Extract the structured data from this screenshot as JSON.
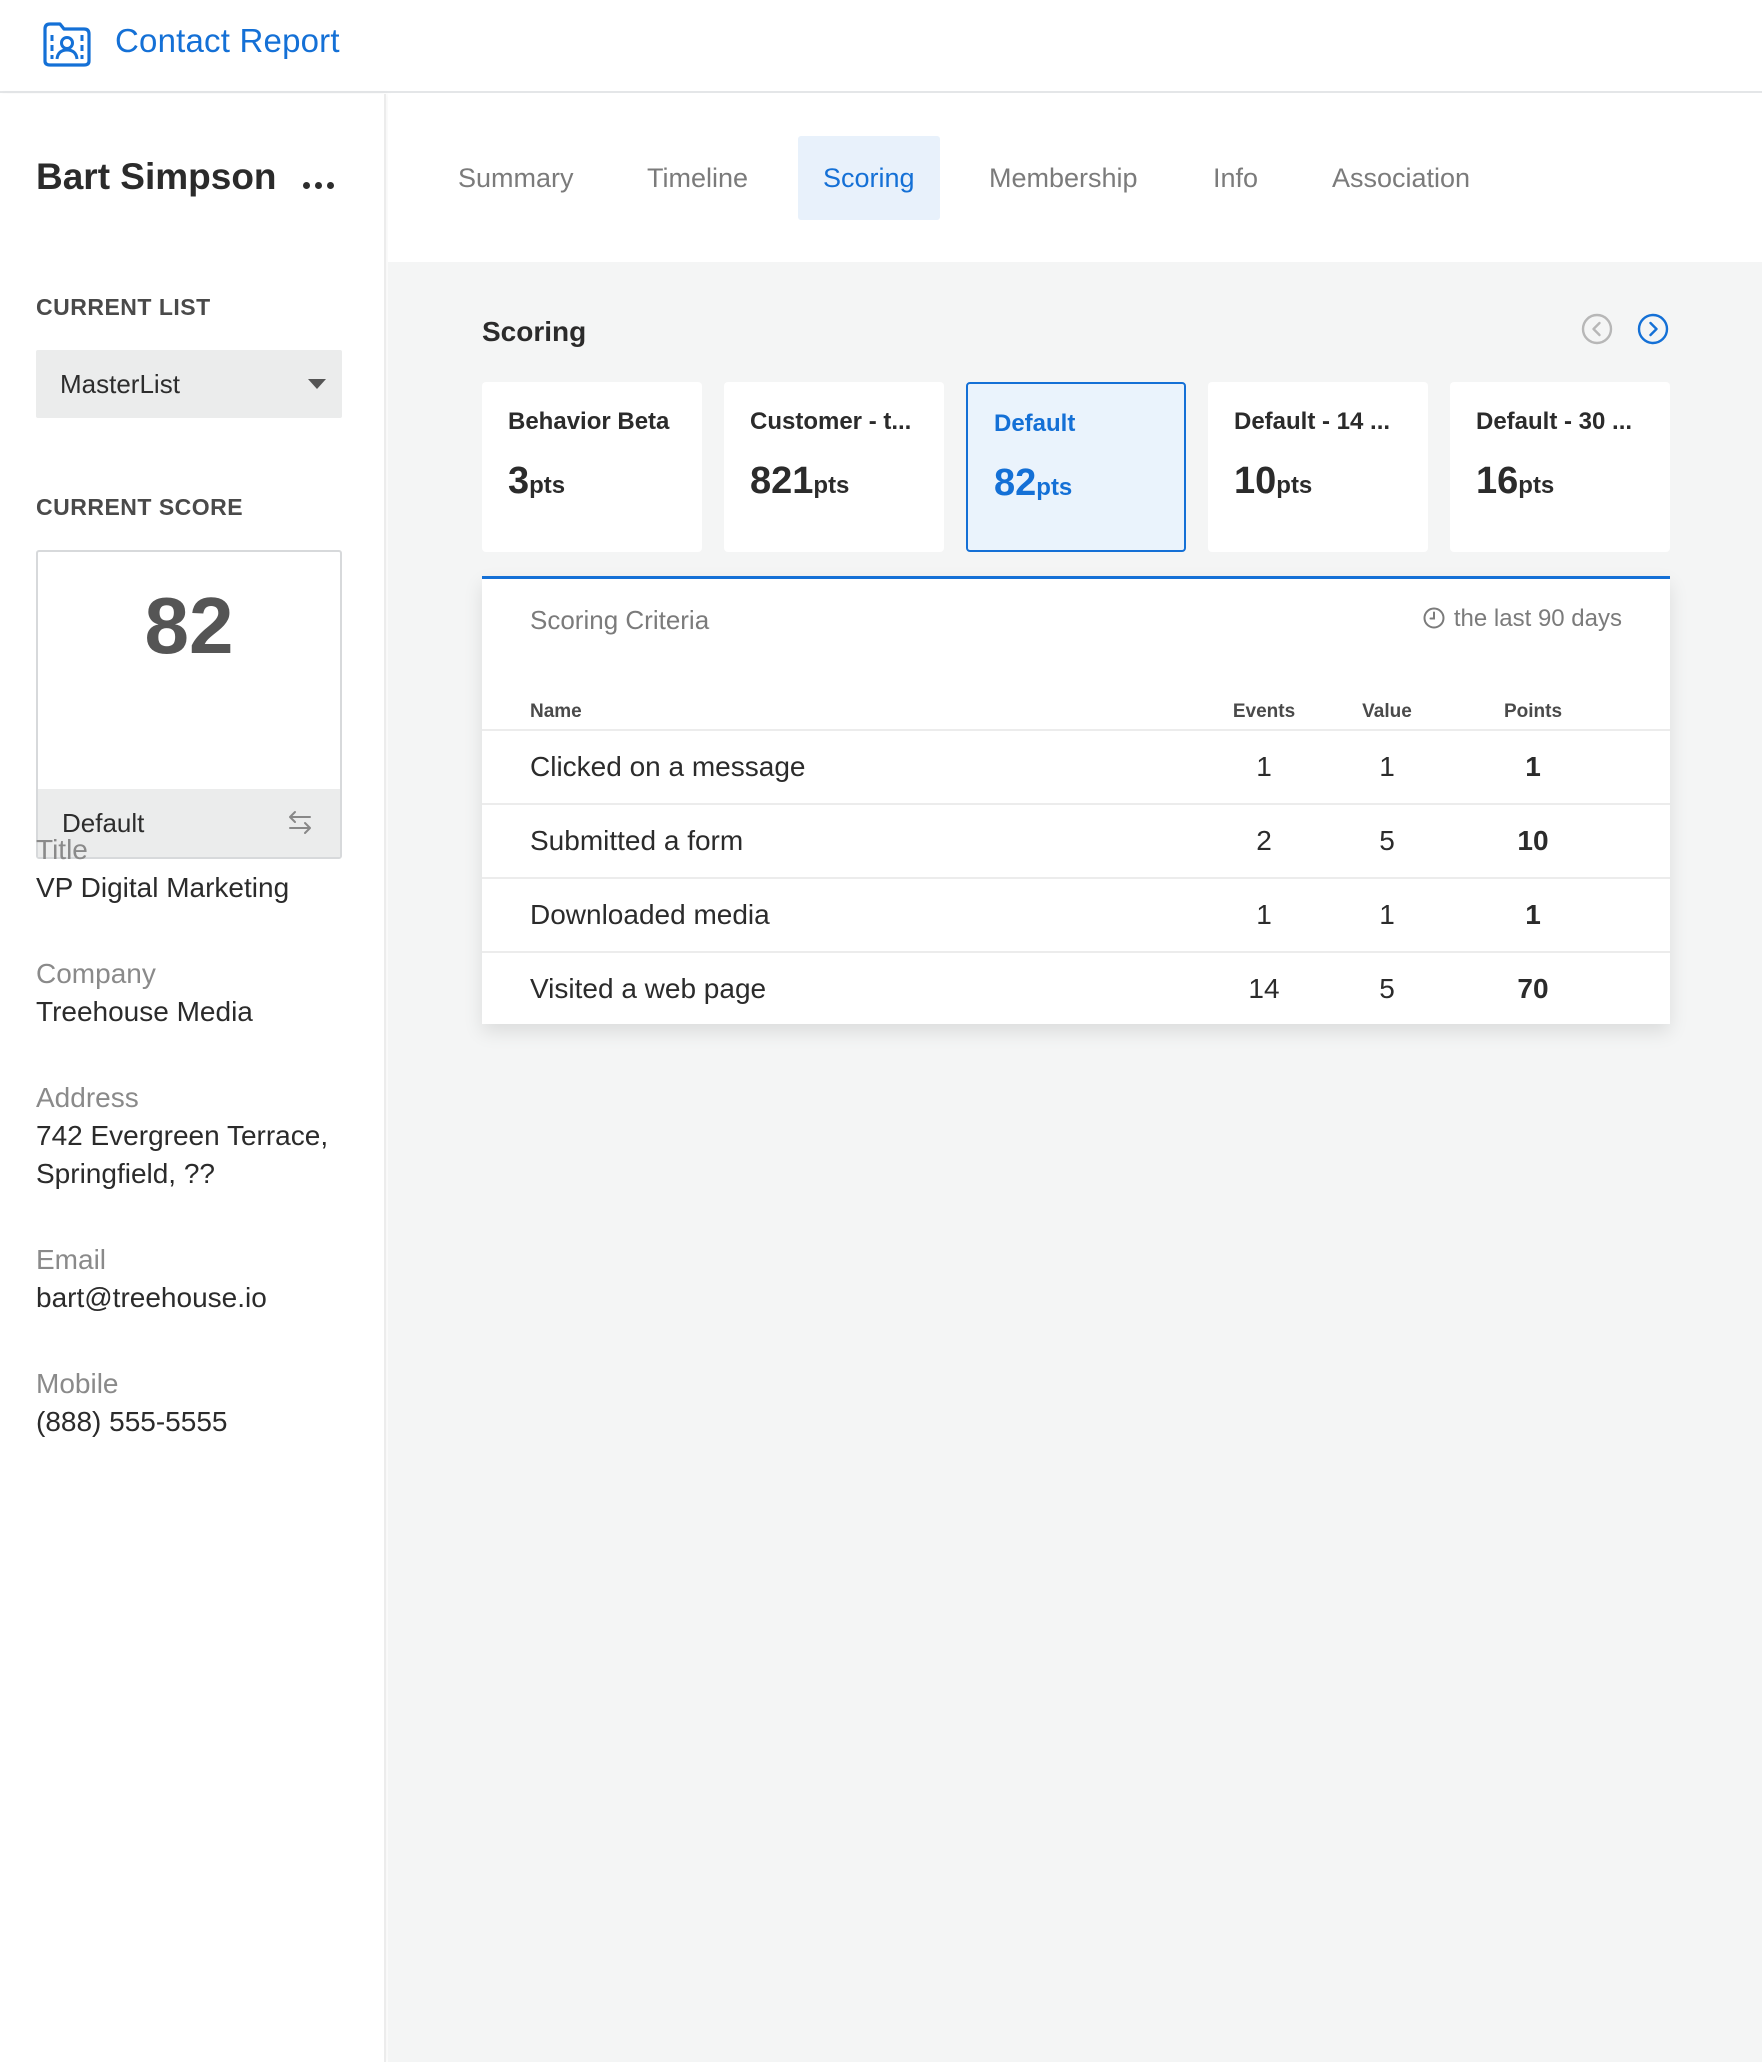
{
  "app": {
    "title": "Contact Report",
    "icon": "contact-folder-icon"
  },
  "contact": {
    "name": "Bart Simpson"
  },
  "sidebar": {
    "current_list_label": "CURRENT LIST",
    "current_list_value": "MasterList",
    "current_score_label": "CURRENT SCORE",
    "current_score_value": "82",
    "current_score_model": "Default",
    "fields": [
      {
        "label": "Title",
        "value": "VP Digital Marketing"
      },
      {
        "label": "Company",
        "value": "Treehouse Media"
      },
      {
        "label": "Address",
        "value": "742 Evergreen Terrace, Springfield, ??"
      },
      {
        "label": "Email",
        "value": "bart@treehouse.io"
      },
      {
        "label": "Mobile",
        "value": "(888) 555-5555"
      }
    ]
  },
  "tabs": [
    {
      "label": "Summary",
      "active": false
    },
    {
      "label": "Timeline",
      "active": false
    },
    {
      "label": "Scoring",
      "active": true
    },
    {
      "label": "Membership",
      "active": false
    },
    {
      "label": "Info",
      "active": false
    },
    {
      "label": "Association",
      "active": false
    }
  ],
  "scoring": {
    "title": "Scoring",
    "pts_suffix": "pts",
    "cards": [
      {
        "name": "Behavior Beta",
        "points": "3",
        "active": false
      },
      {
        "name": "Customer - t...",
        "points": "821",
        "active": false
      },
      {
        "name": "Default",
        "points": "82",
        "active": true
      },
      {
        "name": "Default - 14 ...",
        "points": "10",
        "active": false
      },
      {
        "name": "Default - 30 ...",
        "points": "16",
        "active": false
      }
    ],
    "criteria": {
      "title": "Scoring Criteria",
      "range": "the last 90 days",
      "headers": {
        "name": "Name",
        "events": "Events",
        "value": "Value",
        "points": "Points"
      },
      "rows": [
        {
          "name": "Clicked on a message",
          "events": "1",
          "value": "1",
          "points": "1"
        },
        {
          "name": "Submitted a form",
          "events": "2",
          "value": "5",
          "points": "10"
        },
        {
          "name": "Downloaded media",
          "events": "1",
          "value": "1",
          "points": "1"
        },
        {
          "name": "Visited a web page",
          "events": "14",
          "value": "5",
          "points": "70"
        }
      ]
    }
  },
  "colors": {
    "accent": "#1470d6",
    "accent_bg": "#e8f1fb",
    "main_bg": "#f4f5f5"
  }
}
